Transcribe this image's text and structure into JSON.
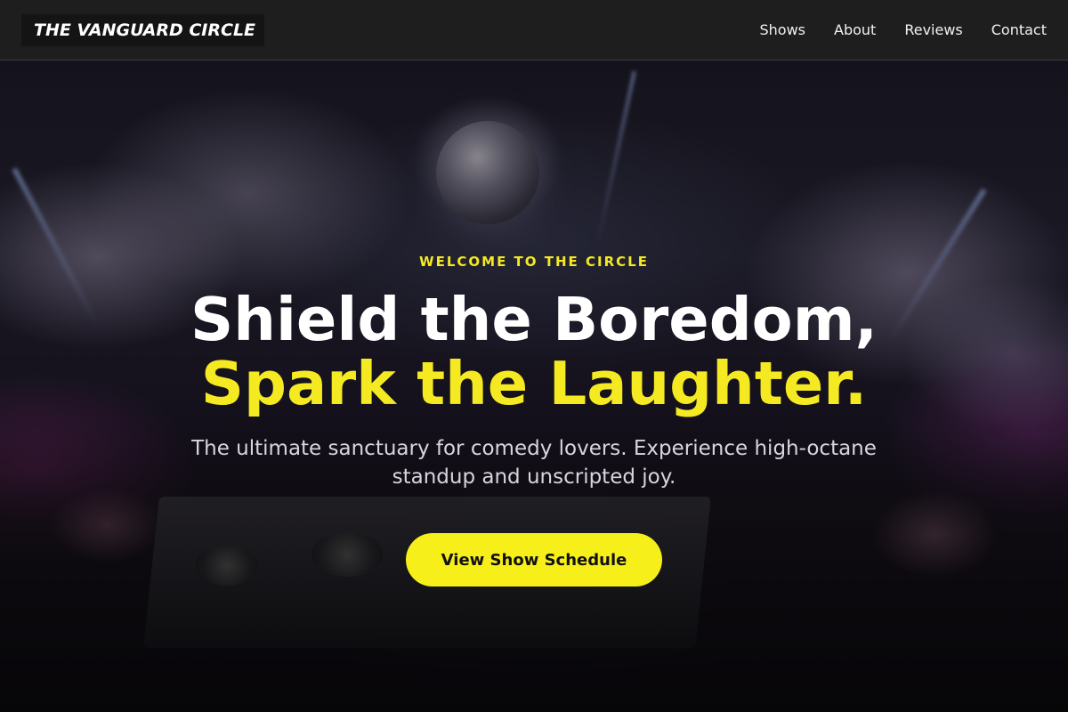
{
  "navbar": {
    "brand": "THE VANGUARD CIRCLE",
    "links": [
      "Shows",
      "About",
      "Reviews",
      "Contact"
    ]
  },
  "hero": {
    "eyebrow": "WELCOME TO THE CIRCLE",
    "headline_line1": "Shield the Boredom,",
    "headline_line2": "Spark the Laughter.",
    "subtitle": "The ultimate sanctuary for comedy lovers. Experience high-octane standup and unscripted joy.",
    "cta_label": "View Show Schedule",
    "background_image": "concert-crowd-dj-photo"
  },
  "colors": {
    "accent": "#f5ea22",
    "navbar_bg": "#1e1e1e",
    "cta_bg": "#f7ef1a",
    "cta_text": "#111111"
  }
}
